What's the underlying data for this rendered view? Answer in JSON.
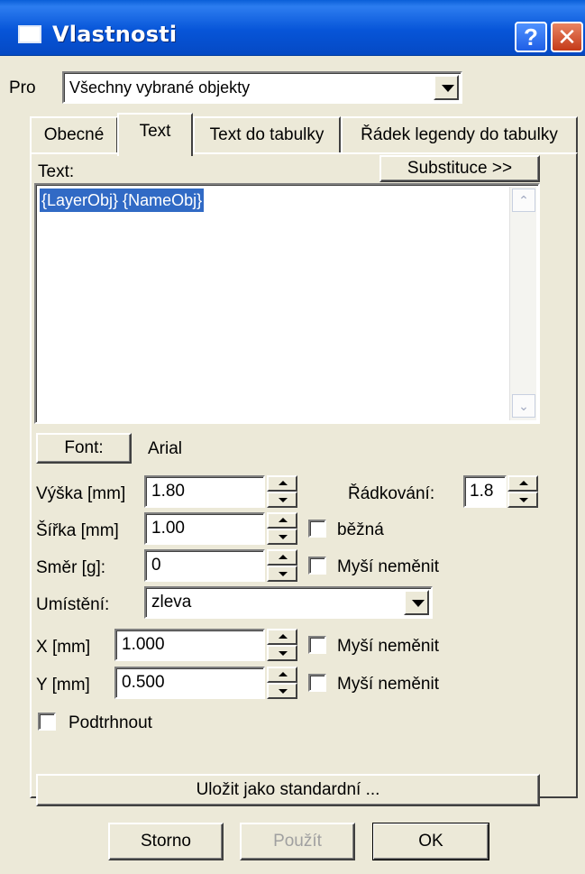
{
  "window": {
    "title": "Vlastnosti",
    "help_glyph": "?",
    "close_glyph": "✕"
  },
  "scope": {
    "label": "Pro",
    "value": "Všechny vybrané objekty"
  },
  "tabs": [
    {
      "label": "Obecné",
      "active": false
    },
    {
      "label": "Text",
      "active": true
    },
    {
      "label": "Text do tabulky",
      "active": false
    },
    {
      "label": "Řádek legendy do tabulky",
      "active": false
    }
  ],
  "text_section": {
    "label": "Text:",
    "substitution_button": "Substituce >>",
    "content": "{LayerObj} {NameObj}"
  },
  "font": {
    "button_label": "Font:",
    "value": "Arial"
  },
  "fields": {
    "height": {
      "label": "Výška [mm]",
      "value": "1.80"
    },
    "line_spacing": {
      "label": "Řádkování:",
      "value": "1.8"
    },
    "width": {
      "label": "Šířka [mm]",
      "value": "1.00"
    },
    "width_check": {
      "label": "běžná",
      "checked": false
    },
    "direction": {
      "label": "Směr [g]:",
      "value": "0"
    },
    "direction_check": {
      "label": "Myší neměnit",
      "checked": false
    },
    "placement": {
      "label": "Umístění:",
      "value": "zleva"
    },
    "x": {
      "label": "X [mm]",
      "value": "1.000"
    },
    "x_check": {
      "label": "Myší neměnit",
      "checked": false
    },
    "y": {
      "label": "Y [mm]",
      "value": "0.500"
    },
    "y_check": {
      "label": "Myší neměnit",
      "checked": false
    },
    "underline": {
      "label": "Podtrhnout",
      "checked": false
    }
  },
  "buttons": {
    "save_default": "Uložit jako standardní ...",
    "cancel": "Storno",
    "apply": "Použít",
    "ok": "OK"
  },
  "colors": {
    "titlebar": "#0755d8",
    "selection": "#316ac5",
    "face": "#ece9d8"
  }
}
